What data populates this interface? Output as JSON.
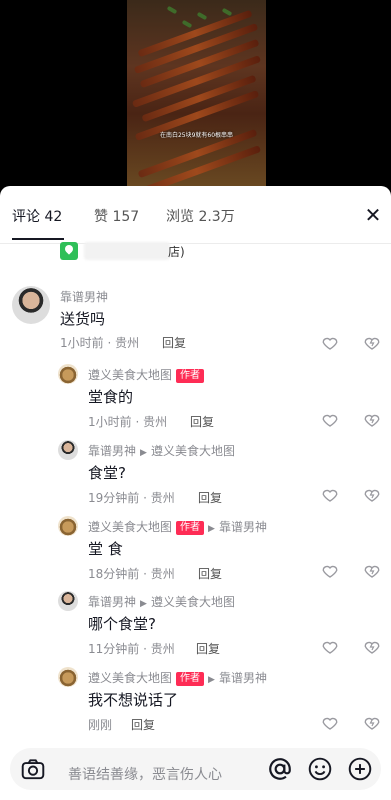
{
  "video": {
    "caption": "在南白25块9就有60根串串"
  },
  "tabs": {
    "comments": "评论 42",
    "likes": "赞 157",
    "views": "浏览 2.3万"
  },
  "location": {
    "suffix": "店)"
  },
  "comments": [
    {
      "name": "靠谱男神",
      "text": "送货吗",
      "time": "1小时前 · 贵州",
      "reply": "回复"
    },
    {
      "name": "遵义美食大地图",
      "badge": "作者",
      "text": "堂食的",
      "time": "1小时前 · 贵州",
      "reply": "回复"
    },
    {
      "name": "靠谱男神",
      "to": "遵义美食大地图",
      "text": "食堂?",
      "time": "19分钟前 · 贵州",
      "reply": "回复"
    },
    {
      "name": "遵义美食大地图",
      "badge": "作者",
      "to": "靠谱男神",
      "text": "堂 食",
      "time": "18分钟前 · 贵州",
      "reply": "回复"
    },
    {
      "name": "靠谱男神",
      "to": "遵义美食大地图",
      "text": "哪个食堂?",
      "time": "11分钟前 · 贵州",
      "reply": "回复"
    },
    {
      "name": "遵义美食大地图",
      "badge": "作者",
      "to": "靠谱男神",
      "text": "我不想说话了",
      "time": "刚刚",
      "reply": "回复"
    }
  ],
  "input": {
    "placeholder": "善语结善缘，恶言伤人心"
  }
}
